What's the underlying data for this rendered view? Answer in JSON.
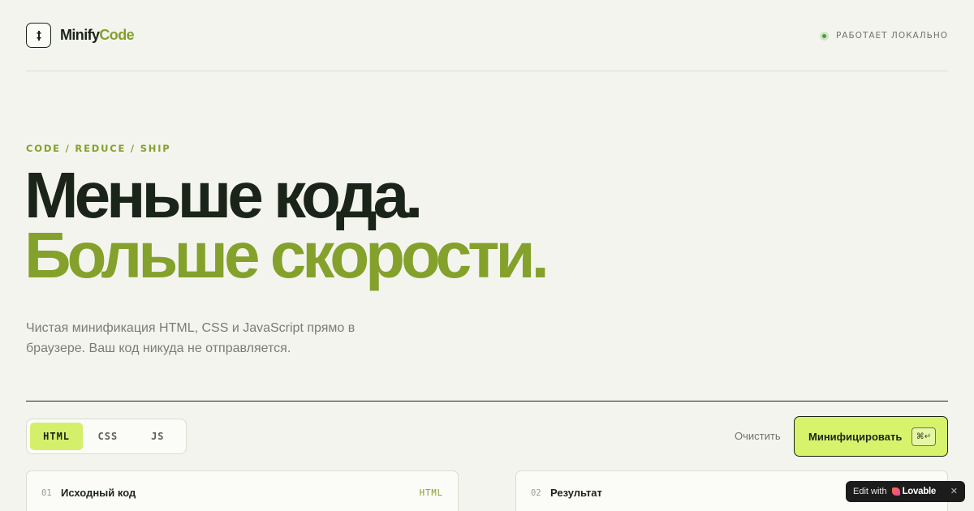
{
  "header": {
    "logo_primary": "Minify",
    "logo_accent": "Code",
    "status_text": "РАБОТАЕТ ЛОКАЛЬНО",
    "status_color": "#4f9a3a"
  },
  "hero": {
    "eyebrow": "CODE / REDUCE / SHIP",
    "headline_line1": "Меньше кода.",
    "headline_line2": "Больше скорости.",
    "lead": "Чистая минификация HTML, CSS и JavaScript прямо в браузере. Ваш код никуда не отправляется."
  },
  "toolbar": {
    "tabs": [
      {
        "label": "HTML",
        "active": true
      },
      {
        "label": "CSS",
        "active": false
      },
      {
        "label": "JS",
        "active": false
      }
    ],
    "clear_label": "Очистить",
    "minify_label": "Минифицировать",
    "shortcut": "⌘↵"
  },
  "panels": {
    "input": {
      "number": "01",
      "title": "Исходный код",
      "lang": "HTML"
    },
    "output": {
      "number": "02",
      "title": "Результат"
    }
  },
  "badge": {
    "prefix": "Edit with",
    "brand": "Lovable",
    "close": "✕"
  },
  "colors": {
    "accent": "#84a12c",
    "button": "#d7f36c",
    "background": "#f4f4ef",
    "ink": "#1b2418"
  }
}
